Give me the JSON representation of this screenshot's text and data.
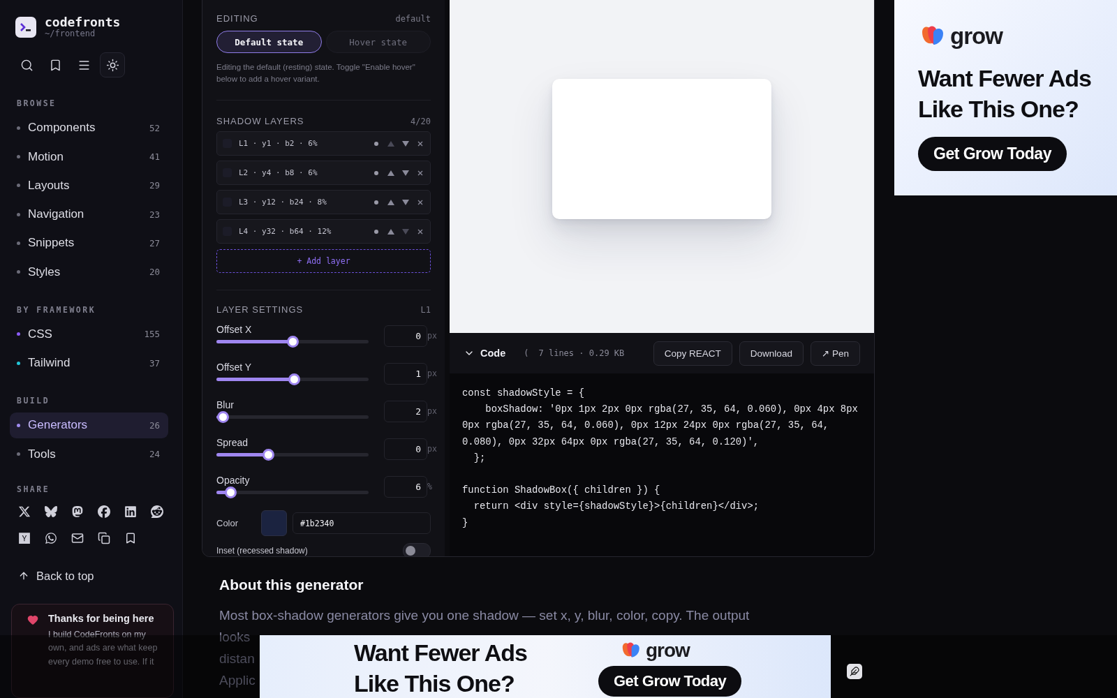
{
  "brand": {
    "name": "codefronts",
    "path": "~/frontend"
  },
  "toolbar": [
    {
      "kind": "search",
      "selected": false
    },
    {
      "kind": "bookmark",
      "selected": false
    },
    {
      "kind": "menu",
      "selected": false
    },
    {
      "kind": "theme",
      "selected": true
    }
  ],
  "sections": [
    {
      "title": "BROWSE",
      "items": [
        {
          "label": "Components",
          "count": "52",
          "color": "#6b6b78",
          "selected": false
        },
        {
          "label": "Motion",
          "count": "41",
          "color": "#6b6b78",
          "selected": false
        },
        {
          "label": "Layouts",
          "count": "29",
          "color": "#6b6b78",
          "selected": false
        },
        {
          "label": "Navigation",
          "count": "23",
          "color": "#6b6b78",
          "selected": false
        },
        {
          "label": "Snippets",
          "count": "27",
          "color": "#6b6b78",
          "selected": false
        },
        {
          "label": "Styles",
          "count": "20",
          "color": "#6b6b78",
          "selected": false
        }
      ]
    },
    {
      "title": "BY FRAMEWORK",
      "items": [
        {
          "label": "CSS",
          "count": "155",
          "color": "#8b5cf6",
          "selected": false
        },
        {
          "label": "Tailwind",
          "count": "37",
          "color": "#22c5d6",
          "selected": false
        }
      ]
    },
    {
      "title": "BUILD",
      "items": [
        {
          "label": "Generators",
          "count": "26",
          "color": "#a08cf0",
          "selected": true
        },
        {
          "label": "Tools",
          "count": "24",
          "color": "#6b6b78",
          "selected": false
        }
      ]
    }
  ],
  "share": {
    "title": "SHARE"
  },
  "back_to_top": "Back to top",
  "thanks_card": {
    "title": "Thanks for being here",
    "lines": [
      "I build CodeFronts on my",
      "own, and ads are what keep",
      "every demo free to use. If it"
    ]
  },
  "editing": {
    "title": "EDITING",
    "mode": "default",
    "tabs": [
      {
        "label": "Default state",
        "selected": true
      },
      {
        "label": "Hover state",
        "selected": false
      }
    ],
    "hint": "Editing the default (resting) state. Toggle \"Enable hover\" below to add a hover variant."
  },
  "layers": {
    "title": "SHADOW LAYERS",
    "count": "4/20",
    "items": [
      {
        "label": "L1 · y1 · b2 · 6%"
      },
      {
        "label": "L2 · y4 · b8 · 6%"
      },
      {
        "label": "L3 · y12 · b24 · 8%"
      },
      {
        "label": "L4 · y32 · b64 · 12%"
      }
    ],
    "add_label": "+ Add layer"
  },
  "settings": {
    "title": "LAYER SETTINGS",
    "layer": "L1",
    "sliders": [
      {
        "label": "Offset X",
        "value": "0",
        "unit": "px",
        "level": 0.5
      },
      {
        "label": "Offset Y",
        "value": "1",
        "unit": "px",
        "level": 0.51
      },
      {
        "label": "Blur",
        "value": "2",
        "unit": "px",
        "level": 0.04
      },
      {
        "label": "Spread",
        "value": "0",
        "unit": "px",
        "level": 0.34
      },
      {
        "label": "Opacity",
        "value": "6",
        "unit": "%",
        "level": 0.09
      }
    ],
    "color": {
      "label": "Color",
      "value": "#1b2340"
    },
    "inset": {
      "label": "Inset (recessed shadow)",
      "on": false
    }
  },
  "code": {
    "title": "Code",
    "expanded": true,
    "meta_mark": "(",
    "meta": "7 lines · 0.29 KB",
    "buttons": [
      "Copy REACT",
      "Download",
      "↗ Pen"
    ],
    "blocks": [
      "const shadowStyle = {\n    boxShadow: '0px 1px 2px 0px rgba(27, 35, 64, 0.060), 0px 4px 8px 0px rgba(27, 35, 64, 0.060), 0px 12px 24px 0px rgba(27, 35, 64, 0.080), 0px 32px 64px 0px rgba(27, 35, 64, 0.120)',\n  };",
      "function ShadowBox({ children }) {\n  return <div style={shadowStyle}>{children}</div>;\n}"
    ]
  },
  "about": {
    "title": "About this generator",
    "lines": [
      "Most box-shadow generators give you one shadow — set x, y, blur, color, copy. The output",
      "looks",
      "distan",
      "Applic"
    ]
  },
  "side_ad": {
    "brand": "grow",
    "headline": "Want Fewer Ads Like This One?",
    "cta": "Get Grow Today"
  },
  "bottom_ad": {
    "brand": "grow",
    "headline": "Want Fewer Ads Like This One?",
    "cta": "Get Grow Today"
  }
}
